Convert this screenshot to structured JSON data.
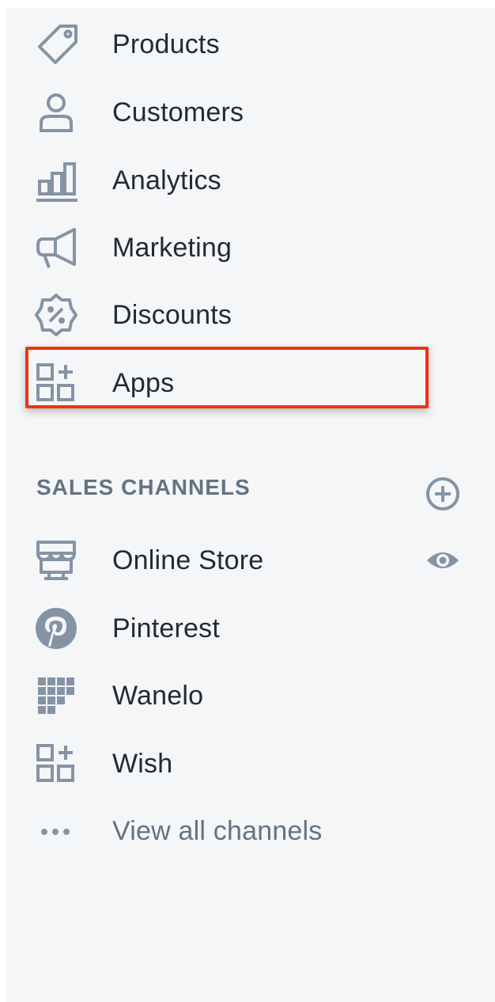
{
  "nav": {
    "items": [
      {
        "label": "Products",
        "icon": "tag-icon"
      },
      {
        "label": "Customers",
        "icon": "person-icon"
      },
      {
        "label": "Analytics",
        "icon": "bar-chart-icon"
      },
      {
        "label": "Marketing",
        "icon": "megaphone-icon"
      },
      {
        "label": "Discounts",
        "icon": "discount-badge-icon"
      },
      {
        "label": "Apps",
        "icon": "apps-grid-plus-icon"
      }
    ]
  },
  "sales_channels": {
    "header": "SALES CHANNELS",
    "items": [
      {
        "label": "Online Store",
        "icon": "storefront-icon"
      },
      {
        "label": "Pinterest",
        "icon": "pinterest-icon"
      },
      {
        "label": "Wanelo",
        "icon": "wanelo-grid-icon"
      },
      {
        "label": "Wish",
        "icon": "apps-grid-plus-icon"
      },
      {
        "label": "View all channels",
        "icon": "ellipsis-icon"
      }
    ]
  },
  "highlight": {
    "target": "Apps",
    "color": "#ee3412"
  },
  "colors": {
    "sidebar_bg": "#f4f6f8",
    "text": "#212b36",
    "muted": "#637381",
    "icon": "#8494a5"
  }
}
